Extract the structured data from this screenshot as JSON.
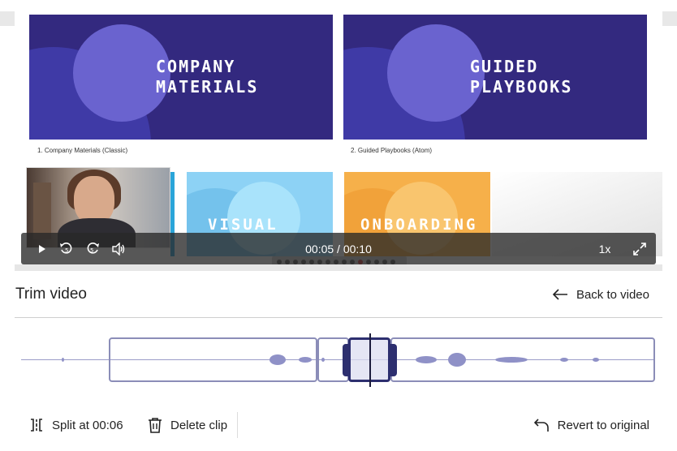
{
  "video": {
    "cards": [
      {
        "title": "COMPANY\nMATERIALS",
        "caption": "1. Company Materials (Classic)"
      },
      {
        "title": "GUIDED\nPLAYBOOKS",
        "caption": "2. Guided Playbooks (Atom)"
      },
      {
        "title": "VISUAL"
      },
      {
        "title": "ONBOARDING"
      }
    ],
    "time_display": "00:05 / 00:10",
    "speed": "1x",
    "progress_fraction": 0.5,
    "icons": {
      "play": "play-icon",
      "rewind": "rewind-5-icon",
      "forward": "forward-5-icon",
      "volume": "volume-icon",
      "fullscreen": "fullscreen-icon"
    }
  },
  "trim": {
    "title": "Trim video",
    "back_label": "Back to video"
  },
  "footer": {
    "split_label": "Split at 00:06",
    "delete_label": "Delete clip",
    "revert_label": "Revert to original"
  },
  "colors": {
    "accent": "#2d2f6f",
    "waveform": "#8f91c7",
    "card_purple": "#33297f"
  }
}
